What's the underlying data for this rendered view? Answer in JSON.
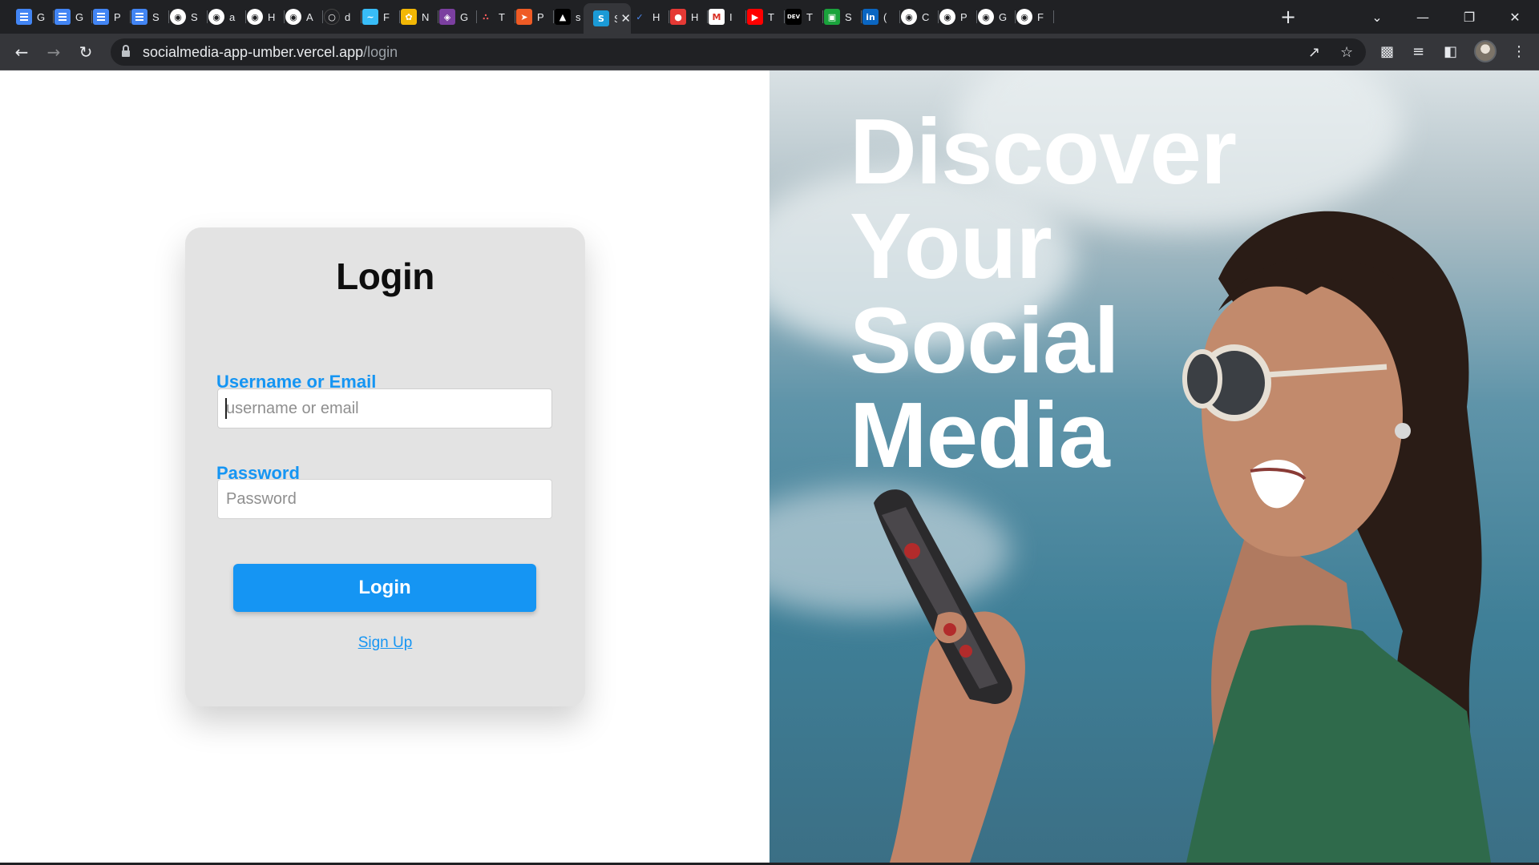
{
  "browser": {
    "tabs": [
      {
        "icon": "google-docs-icon",
        "label": "G",
        "active": false
      },
      {
        "icon": "google-docs-icon",
        "label": "G",
        "active": false
      },
      {
        "icon": "google-docs-icon",
        "label": "P",
        "active": false
      },
      {
        "icon": "google-docs-icon",
        "label": "S",
        "active": false
      },
      {
        "icon": "github-icon",
        "label": "S",
        "active": false
      },
      {
        "icon": "github-icon",
        "label": "a",
        "active": false
      },
      {
        "icon": "github-icon",
        "label": "H",
        "active": false
      },
      {
        "icon": "github-icon",
        "label": "A",
        "active": false
      },
      {
        "icon": "circle-icon",
        "label": "d",
        "active": false
      },
      {
        "icon": "tailwind-icon",
        "label": "F",
        "active": false
      },
      {
        "icon": "flower-icon",
        "label": "N",
        "active": false
      },
      {
        "icon": "graphql-icon",
        "label": "G",
        "active": false
      },
      {
        "icon": "dots-icon",
        "label": "T",
        "active": false
      },
      {
        "icon": "postman-icon",
        "label": "P",
        "active": false
      },
      {
        "icon": "vercel-icon",
        "label": "s",
        "active": false
      },
      {
        "icon": "s-badge-icon",
        "label": "S",
        "active": true
      },
      {
        "icon": "check-icon",
        "label": "H",
        "active": false
      },
      {
        "icon": "pokeball-icon",
        "label": "H",
        "active": false
      },
      {
        "icon": "gmail-icon",
        "label": "I",
        "active": false
      },
      {
        "icon": "youtube-icon",
        "label": "T",
        "active": false
      },
      {
        "icon": "dev-icon",
        "label": "T",
        "active": false
      },
      {
        "icon": "green-box-icon",
        "label": "S",
        "active": false
      },
      {
        "icon": "linkedin-icon",
        "label": "(",
        "active": false
      },
      {
        "icon": "github-icon",
        "label": "C",
        "active": false
      },
      {
        "icon": "github-icon",
        "label": "P",
        "active": false
      },
      {
        "icon": "github-icon",
        "label": "G",
        "active": false
      },
      {
        "icon": "github-icon",
        "label": "F",
        "active": false
      }
    ],
    "url_host": "socialmedia-app-umber.vercel.app",
    "url_path": "/login"
  },
  "login": {
    "title": "Login",
    "username_label": "Username or Email",
    "username_placeholder": "username or email",
    "password_label": "Password",
    "password_placeholder": "Password",
    "submit_label": "Login",
    "signup_label": "Sign Up",
    "accent_color": "#1595f3"
  },
  "hero": {
    "line1": "Discover",
    "line2": "Your",
    "line3": "Social",
    "line4": "Media"
  }
}
